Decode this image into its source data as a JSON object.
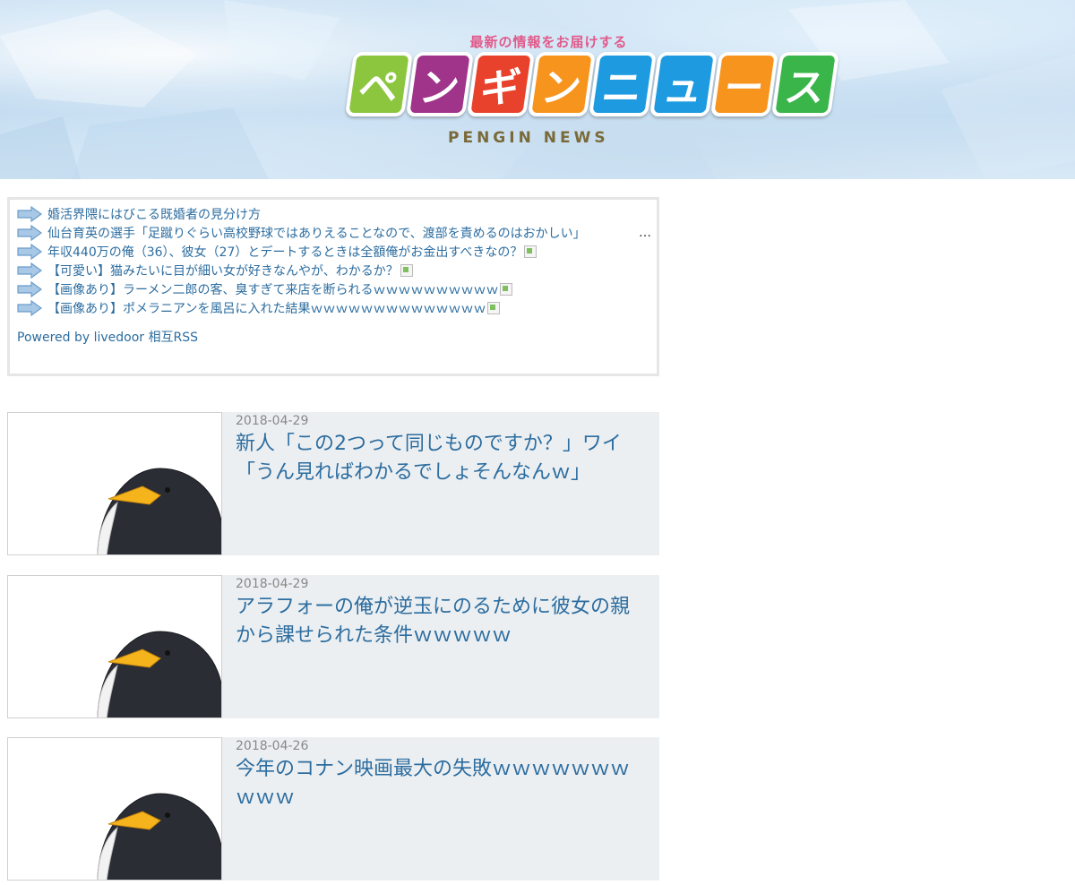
{
  "header": {
    "tagline": "最新の情報をお届けする",
    "logo_kana": [
      "ペ",
      "ン",
      "ギ",
      "ン",
      "ニ",
      "ュ",
      "ー",
      "ス"
    ],
    "logo_en": "PENGIN NEWS"
  },
  "colors": {
    "link": "#2c6da0",
    "card_bg": "#eceff1",
    "logo": [
      "#8cc63f",
      "#a0338a",
      "#e8412c",
      "#f7941d",
      "#1e9be0",
      "#1e9be0",
      "#f7941d",
      "#39b54a"
    ]
  },
  "rss": {
    "items": [
      {
        "text": "婚活界隈にはびこる既婚者の見分け方",
        "has_image": false,
        "ellipsis": false
      },
      {
        "text": "仙台育英の選手「足蹴りぐらい高校野球ではありえることなので、渡部を責めるのはおかしい」",
        "has_image": false,
        "ellipsis": true
      },
      {
        "text": "年収440万の俺（36）、彼女（27）とデートするときは全額俺がお金出すべきなの？",
        "has_image": true,
        "ellipsis": false
      },
      {
        "text": "【可愛い】猫みたいに目が細い女が好きなんやが、わかるか？",
        "has_image": true,
        "ellipsis": false
      },
      {
        "text": "【画像あり】ラーメン二郎の客、臭すぎて来店を断られるｗｗｗｗｗｗｗｗｗｗ",
        "has_image": true,
        "ellipsis": false
      },
      {
        "text": "【画像あり】ポメラニアンを風呂に入れた結果ｗｗｗｗｗｗｗｗｗｗｗｗｗｗ",
        "has_image": true,
        "ellipsis": false
      }
    ],
    "ellipsis_text": "…",
    "powered_by": "Powered by livedoor 相互RSS"
  },
  "articles": [
    {
      "date": "2018-04-29",
      "title": "新人「この2つって同じものですか？」ワイ「うん見ればわかるでしょそんなんｗ」"
    },
    {
      "date": "2018-04-29",
      "title": "アラフォーの俺が逆玉にのるために彼女の親から課せられた条件ｗｗｗｗｗ"
    },
    {
      "date": "2018-04-26",
      "title": "今年のコナン映画最大の失敗ｗｗｗｗｗｗｗｗｗｗ"
    }
  ]
}
